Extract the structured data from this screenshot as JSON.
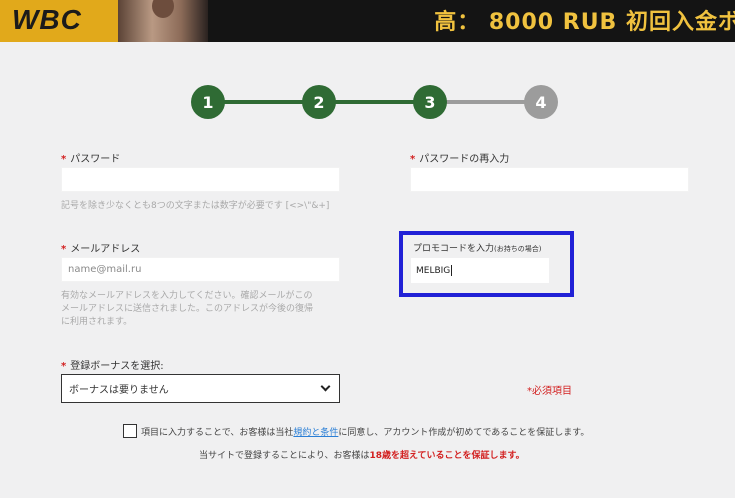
{
  "banner": {
    "logo": "WBC",
    "headline": "高： 8000 RUB 初回入金ボ"
  },
  "stepper": {
    "steps": [
      "1",
      "2",
      "3",
      "4"
    ],
    "current_step": 3
  },
  "form": {
    "password": {
      "label": "パスワード",
      "value": "",
      "hint": "記号を除き少なくとも8つの文字または数字が必要です [<>\\\"&+]"
    },
    "password_confirm": {
      "label": "パスワードの再入力",
      "value": ""
    },
    "email": {
      "label": "メールアドレス",
      "placeholder": "name@mail.ru",
      "hint_lines": [
        "有効なメールアドレスを入力してください。確認メールがこの",
        "メールアドレスに送信されました。このアドレスが今後の復帰",
        "に利用されます。"
      ]
    },
    "promo": {
      "label": "プロモコードを入力",
      "label_sub": "(お持ちの場合)",
      "value": "MELBIG"
    },
    "bonus": {
      "label": "登録ボーナスを選択:",
      "selected": "ボーナスは要りません"
    },
    "required_marker": "*",
    "required_note": "*必須項目",
    "agreement": {
      "text_before": "項目に入力することで、お客様は当社",
      "link": "規約と条件",
      "text_after": "に同意し、アカウント作成が初めてであることを保証します。"
    },
    "age_note": {
      "text_before": "当サイトで登録することにより、お客様は",
      "emphasis": "18歳を超えていることを保証します。"
    }
  },
  "colors": {
    "step_done": "#2f6b34",
    "step_todo": "#9c9c9c",
    "promo_highlight": "#2121d6",
    "required_red": "#d21f1f",
    "link_blue": "#2b7fd6",
    "banner_gold": "#f0c23f"
  }
}
